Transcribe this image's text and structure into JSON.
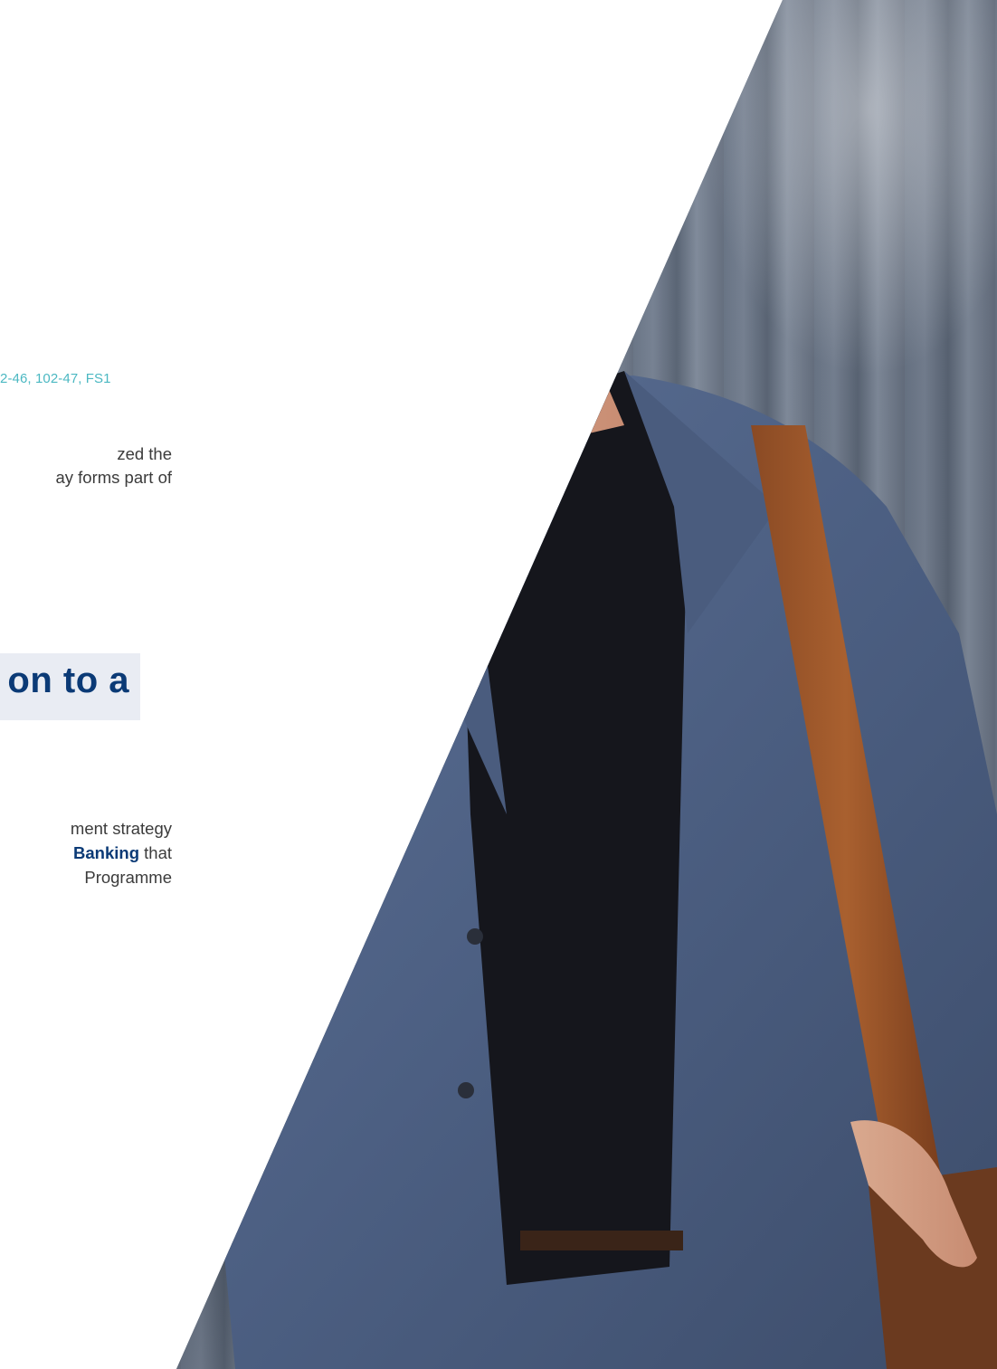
{
  "gri": {
    "tag": "2-46, 102-47, FS1"
  },
  "intro": {
    "line1": "zed the",
    "line2": "ay forms part of"
  },
  "heading": {
    "text": "on to a"
  },
  "body": {
    "line1": "ment strategy",
    "line2_highlight": "Banking",
    "line2_rest": " that",
    "line3": "Programme"
  },
  "colors": {
    "accent_teal": "#4bb8c2",
    "brand_navy": "#0b3a76",
    "heading_bg": "#e9ecf3",
    "body_text": "#3b3b3b"
  },
  "image": {
    "subject": "man-with-smartphone-photo"
  }
}
